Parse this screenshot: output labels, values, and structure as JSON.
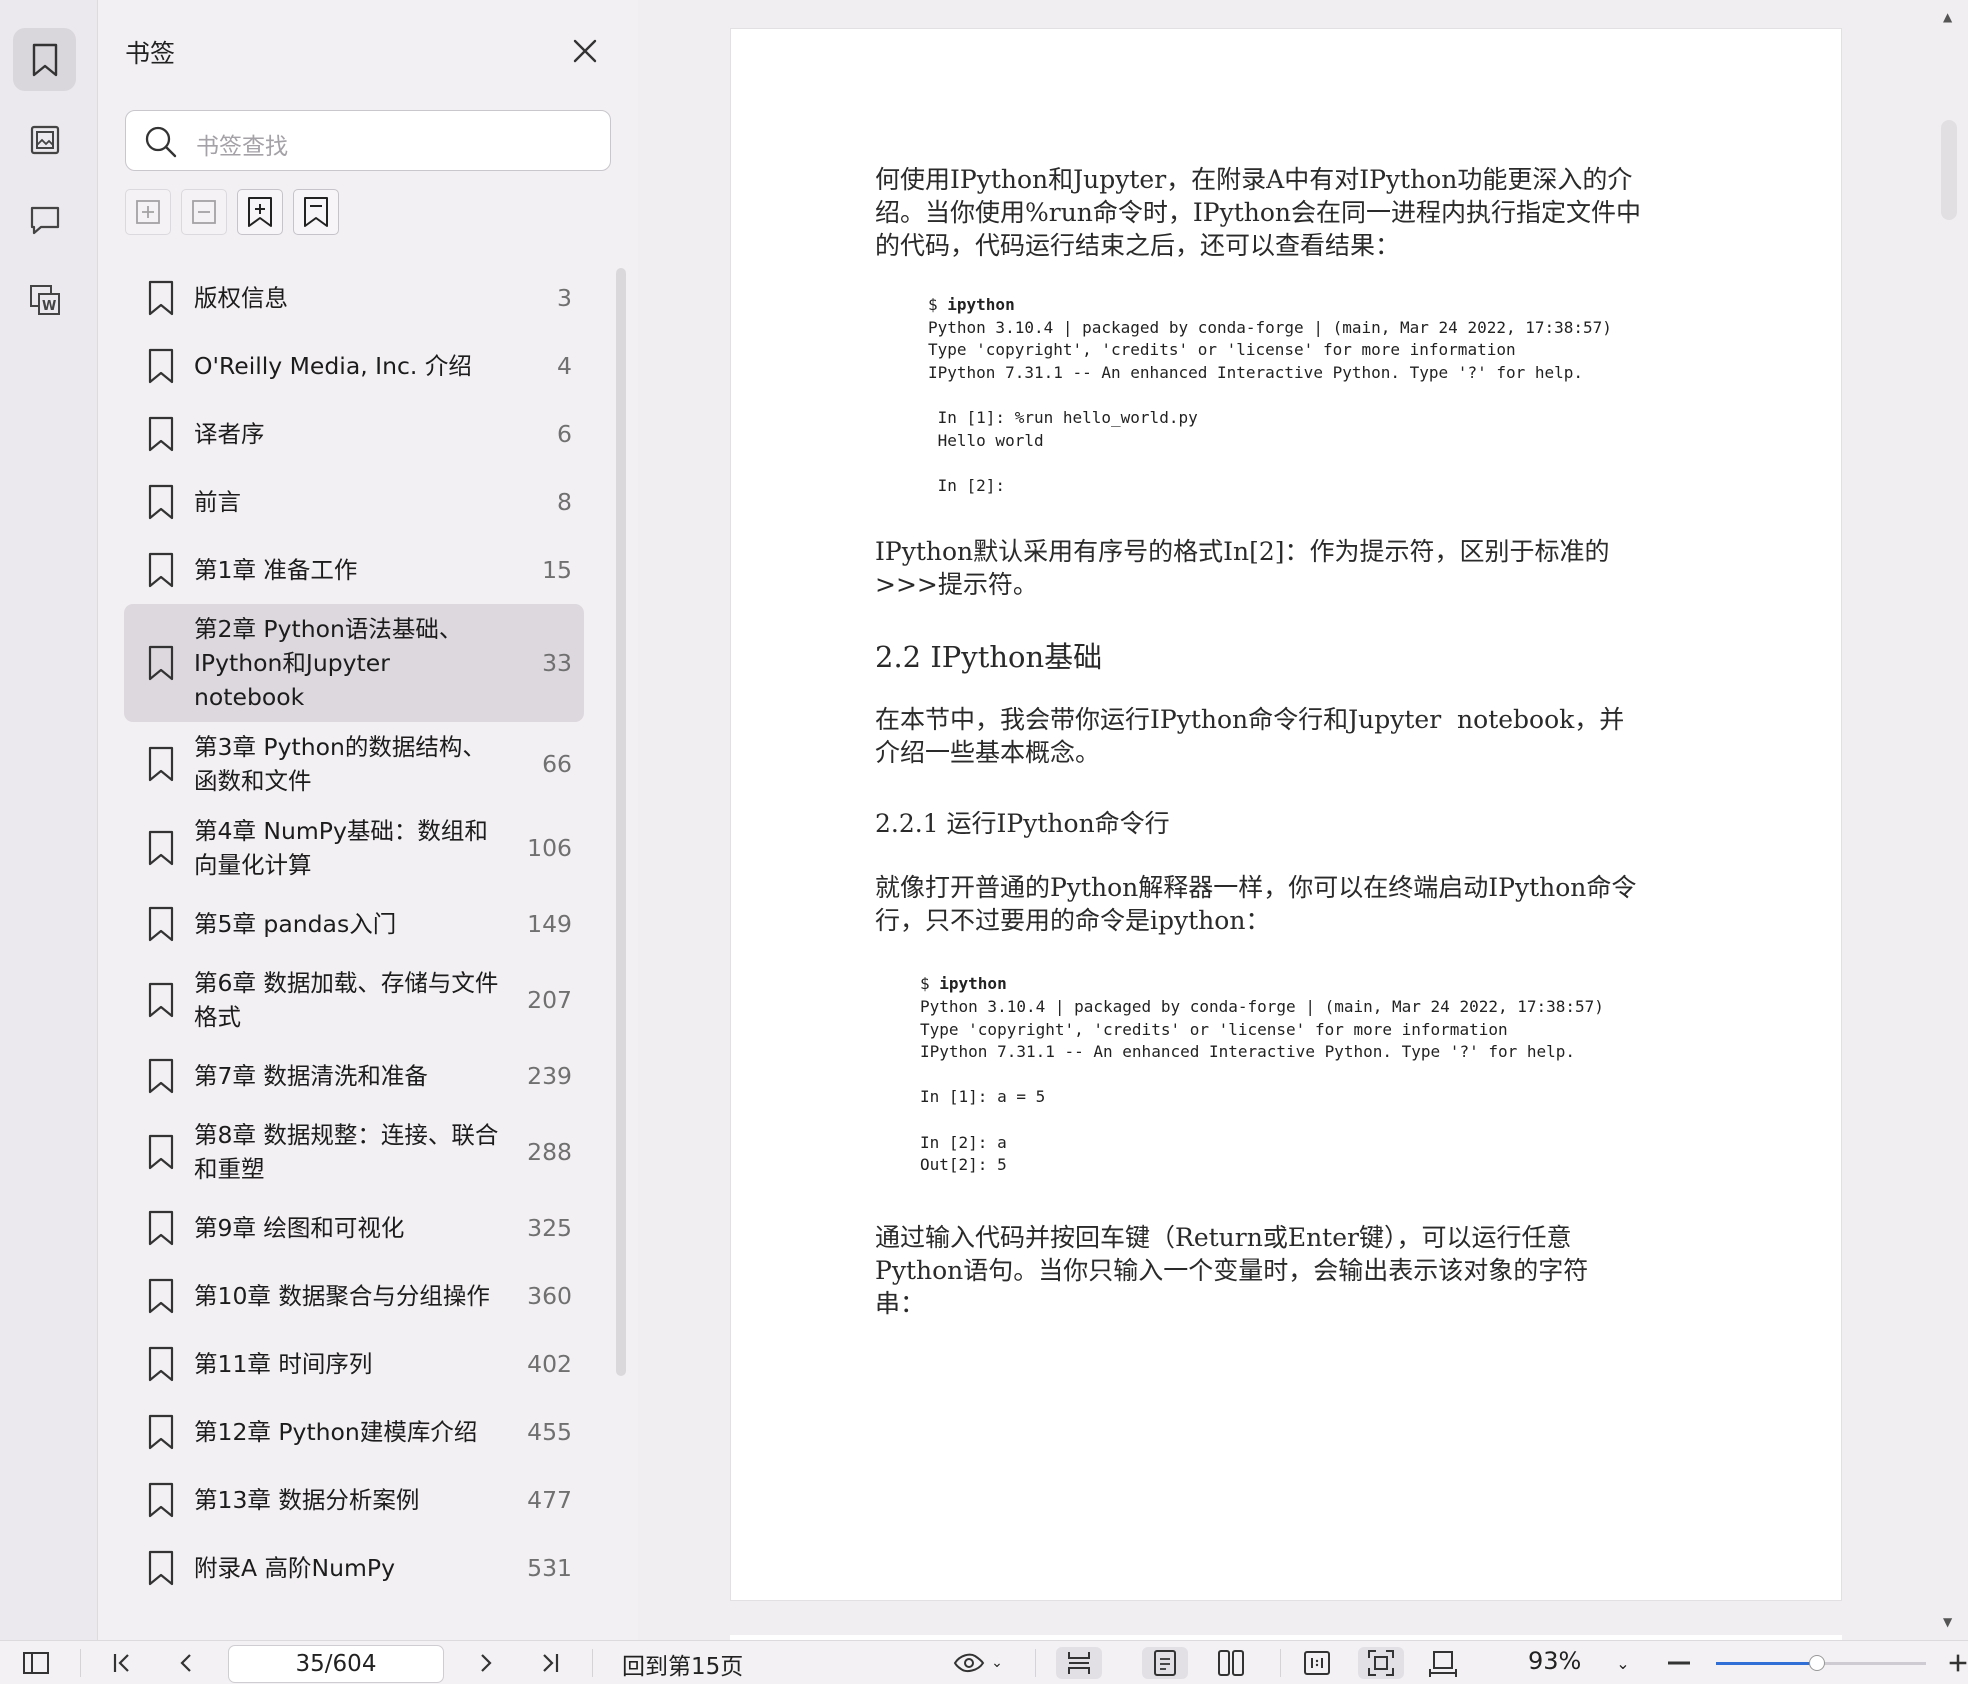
{
  "sidebar": {
    "title": "书签",
    "search_placeholder": "书签查找",
    "items": [
      {
        "label": "版权信息",
        "page": "3",
        "selected": false
      },
      {
        "label": "O'Reilly Media, Inc. 介绍",
        "page": "4",
        "selected": false
      },
      {
        "label": "译者序",
        "page": "6",
        "selected": false
      },
      {
        "label": "前言",
        "page": "8",
        "selected": false
      },
      {
        "label": "第1章 准备工作",
        "page": "15",
        "selected": false
      },
      {
        "label": "第2章 Python语法基础、IPython和Jupyter notebook",
        "page": "33",
        "selected": true
      },
      {
        "label": "第3章 Python的数据结构、函数和文件",
        "page": "66",
        "selected": false
      },
      {
        "label": "第4章 NumPy基础：数组和向量化计算",
        "page": "106",
        "selected": false
      },
      {
        "label": "第5章 pandas入门",
        "page": "149",
        "selected": false
      },
      {
        "label": "第6章 数据加载、存储与文件格式",
        "page": "207",
        "selected": false
      },
      {
        "label": "第7章 数据清洗和准备",
        "page": "239",
        "selected": false
      },
      {
        "label": "第8章 数据规整：连接、联合和重塑",
        "page": "288",
        "selected": false
      },
      {
        "label": "第9章 绘图和可视化",
        "page": "325",
        "selected": false
      },
      {
        "label": "第10章 数据聚合与分组操作",
        "page": "360",
        "selected": false
      },
      {
        "label": "第11章 时间序列",
        "page": "402",
        "selected": false
      },
      {
        "label": "第12章 Python建模库介绍",
        "page": "455",
        "selected": false
      },
      {
        "label": "第13章 数据分析案例",
        "page": "477",
        "selected": false
      },
      {
        "label": "附录A 高阶NumPy",
        "page": "531",
        "selected": false
      }
    ]
  },
  "document": {
    "para1": "何使用IPython和Jupyter，在附录A中有对IPython功能更深入的介\n绍。当你使用%run命令时，IPython会在同一进程内执行指定文件中\n的代码，代码运行结束之后，还可以查看结果：",
    "code1_cmd": "ipython",
    "code1_body": "Python 3.10.4 | packaged by conda-forge | (main, Mar 24 2022, 17:38:57)\nType 'copyright', 'credits' or 'license' for more information\nIPython 7.31.1 -- An enhanced Interactive Python. Type '?' for help.\n\n In [1]: %run hello_world.py\n Hello world\n\n In [2]:",
    "para2": "IPython默认采用有序号的格式In[2]：作为提示符，区别于标准的\n>>>提示符。",
    "heading_2_2": "2.2  IPython基础",
    "para3": "在本节中，我会带你运行IPython命令行和Jupyter  notebook，并\n介绍一些基本概念。",
    "heading_2_2_1": "2.2.1  运行IPython命令行",
    "para4": "就像打开普通的Python解释器一样，你可以在终端启动IPython命令\n行，只不过要用的命令是ipython：",
    "code2_cmd": "ipython",
    "code2_body": "Python 3.10.4 | packaged by conda-forge | (main, Mar 24 2022, 17:38:57)\nType 'copyright', 'credits' or 'license' for more information\nIPython 7.31.1 -- An enhanced Interactive Python. Type '?' for help.\n\nIn [1]: a = 5\n\nIn [2]: a\nOut[2]: 5",
    "para5": "通过输入代码并按回车键（Return或Enter键），可以运行任意\nPython语句。当你只输入一个变量时，会输出表示该对象的字符\n串："
  },
  "toolbar": {
    "page_indicator": "35/604",
    "goto_label": "回到第15页",
    "zoom": "93%",
    "zoom_slider_fraction": 0.48
  },
  "colors": {
    "accent": "#2f6fd6",
    "selected_row": "#dcd8de"
  }
}
